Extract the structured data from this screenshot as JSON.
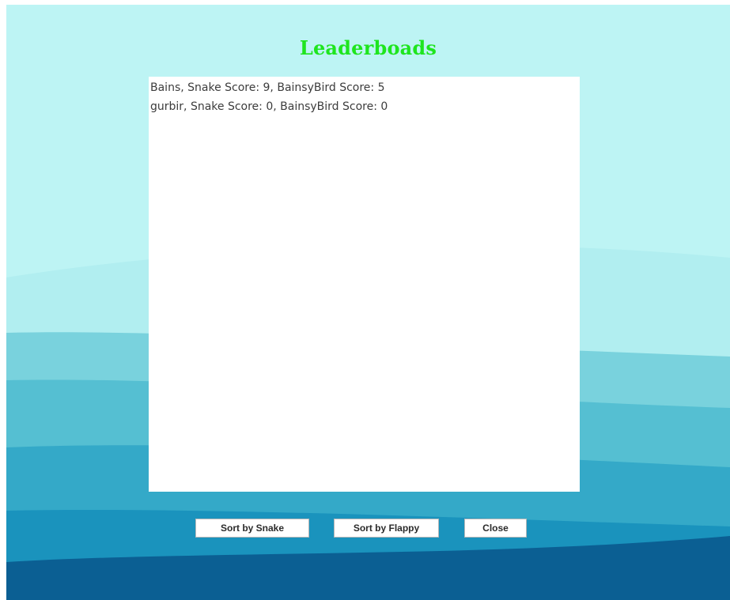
{
  "window": {
    "title": "Leaderboads"
  },
  "leaderboard": {
    "entries": [
      "Bains, Snake Score: 9, BainsyBird Score: 5",
      "gurbir, Snake Score: 0, BainsyBird Score: 0"
    ]
  },
  "buttons": {
    "sort_snake": "Sort by Snake",
    "sort_flappy": "Sort by Flappy",
    "close": "Close"
  },
  "colors": {
    "title": "#1ee51e",
    "sky": "#bdf4f4",
    "wave_light": "#9ee3e8",
    "wave_mid": "#4fb9cf",
    "wave_deep": "#1a93bd",
    "wave_dark": "#0b5f93"
  }
}
